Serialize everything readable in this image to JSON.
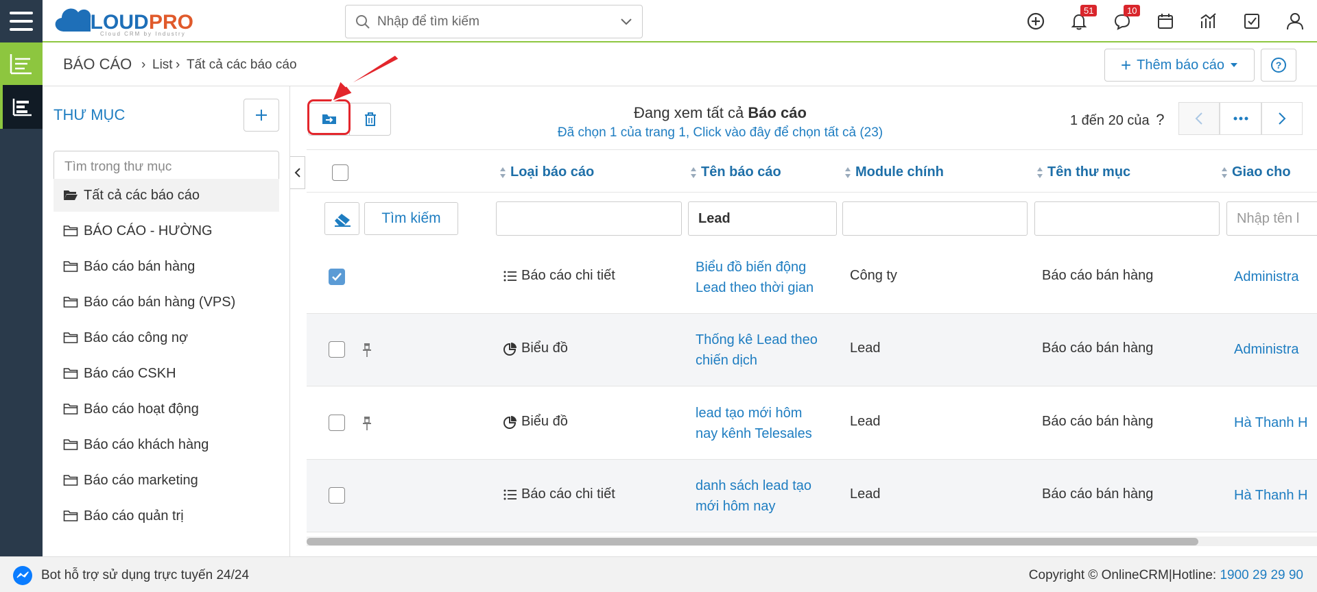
{
  "header": {
    "logo_text": "CLOUDPRO",
    "logo_tagline": "Cloud CRM by Industry",
    "search_placeholder": "Nhập để tìm kiếm",
    "notifications_count": "51",
    "messages_count": "10"
  },
  "breadcrumb": {
    "title": "BÁO CÁO",
    "items": [
      "List",
      "Tất cả các báo cáo"
    ],
    "add_report_label": "Thêm báo cáo"
  },
  "folders": {
    "title": "THƯ MỤC",
    "search_placeholder": "Tìm trong thư mục",
    "items": [
      "Tất cả các báo cáo",
      "BÁO CÁO - HƯỜNG",
      "Báo cáo bán hàng",
      "Báo cáo bán hàng (VPS)",
      "Báo cáo công nợ",
      "Báo cáo CSKH",
      "Báo cáo hoạt động",
      "Báo cáo khách hàng",
      "Báo cáo marketing",
      "Báo cáo quản trị"
    ]
  },
  "list": {
    "viewing_prefix": "Đang xem tất cả",
    "viewing_entity": "Báo cáo",
    "selection_text": "Đã chọn 1 của trang 1, Click vào đây để chọn tất cả (23)",
    "page_info": "1 đến 20 của",
    "page_unknown": "?",
    "search_button": "Tìm kiếm",
    "columns": [
      "Loại báo cáo",
      "Tên báo cáo",
      "Module chính",
      "Tên thư mục",
      "Giao cho"
    ],
    "filters": {
      "type": "",
      "name": "Lead",
      "module": "",
      "folder": "",
      "assignee_placeholder": "Nhập tên l"
    },
    "rows": [
      {
        "checked": true,
        "pinned": false,
        "type": "Báo cáo chi tiết",
        "type_icon": "list-icon",
        "name_line1": "Biểu đồ biến động",
        "name_line2": "Lead theo thời gian",
        "module": "Công ty",
        "folder": "Báo cáo bán hàng",
        "assignee": "Administra"
      },
      {
        "checked": false,
        "pinned": true,
        "type": "Biểu đồ",
        "type_icon": "pie-chart-icon",
        "name_line1": "Thống kê Lead theo",
        "name_line2": "chiến dịch",
        "module": "Lead",
        "folder": "Báo cáo bán hàng",
        "assignee": "Administra"
      },
      {
        "checked": false,
        "pinned": true,
        "type": "Biểu đồ",
        "type_icon": "pie-chart-icon",
        "name_line1": "lead tạo mới hôm",
        "name_line2": "nay kênh Telesales",
        "module": "Lead",
        "folder": "Báo cáo bán hàng",
        "assignee": "Hà Thanh H"
      },
      {
        "checked": false,
        "pinned": false,
        "type": "Báo cáo chi tiết",
        "type_icon": "list-icon",
        "name_line1": "danh sách lead tạo",
        "name_line2": "mới hôm nay",
        "module": "Lead",
        "folder": "Báo cáo bán hàng",
        "assignee": "Hà Thanh H"
      }
    ]
  },
  "footer": {
    "bot_text": "Bot hỗ trợ sử dụng trực tuyến 24/24",
    "copyright": "Copyright © OnlineCRM|Hotline:",
    "hotline": "1900 29 29 90"
  },
  "colors": {
    "accent_green": "#8dc63f",
    "sidebar_dark": "#2a3a4b",
    "link_blue": "#1e7dc1",
    "badge_red": "#d9262c",
    "annotation_red": "#e3262c"
  }
}
